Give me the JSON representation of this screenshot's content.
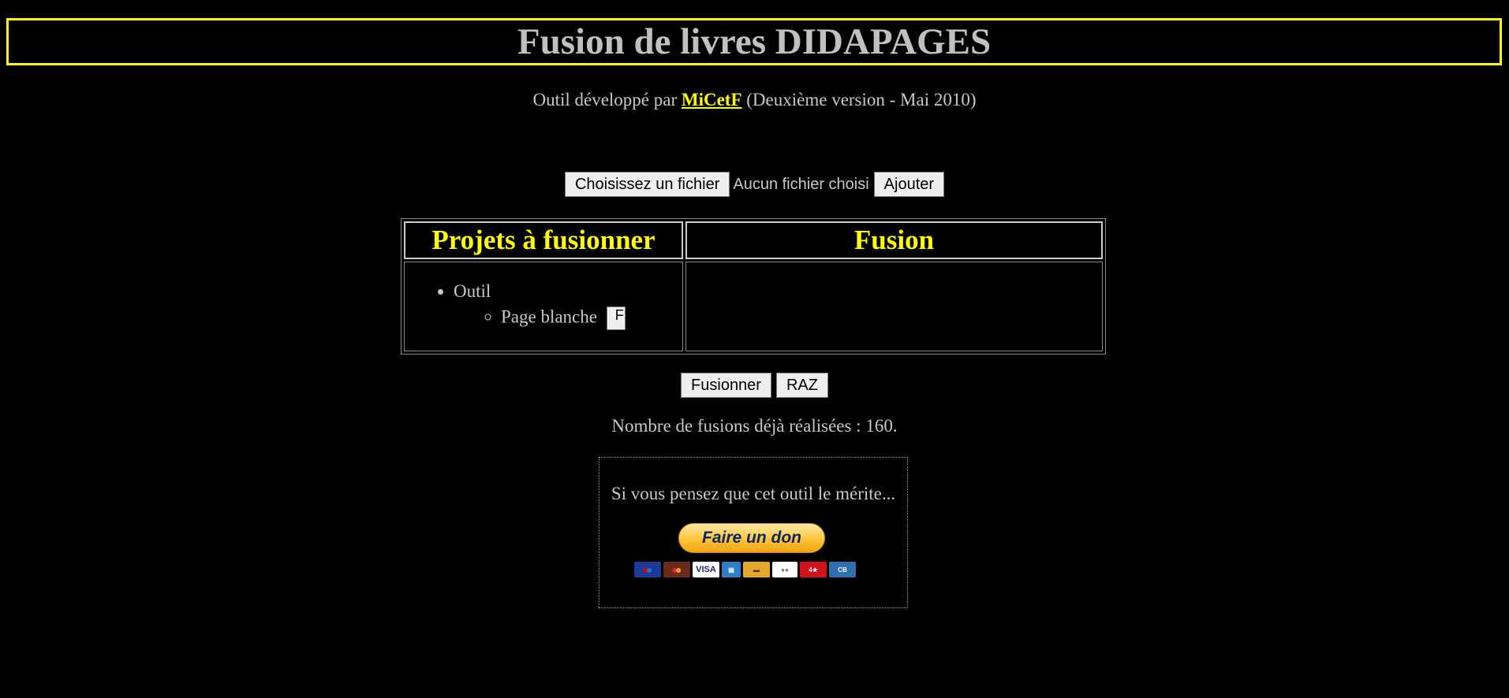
{
  "header": {
    "title": "Fusion de livres DIDAPAGES"
  },
  "credit": {
    "prefix": "Outil développé par ",
    "author": "MiCetF",
    "suffix": " (Deuxième version - Mai 2010)"
  },
  "file_picker": {
    "choose_label": "Choisissez un fichier",
    "status": "Aucun fichier choisi",
    "add_label": "Ajouter"
  },
  "table": {
    "col_projects": "Projets à fusionner",
    "col_fusion": "Fusion",
    "projects": [
      {
        "name": "Outil",
        "pages": [
          {
            "name": "Page blanche",
            "button": "F"
          }
        ]
      }
    ]
  },
  "actions": {
    "merge_label": "Fusionner",
    "reset_label": "RAZ"
  },
  "stats": {
    "count_text": "Nombre de fusions déjà réalisées : 160."
  },
  "donate": {
    "text": "Si vous pensez que cet outil le mérite...",
    "button_label": "Faire un don",
    "card_icons": [
      "maestro-icon",
      "mastercard-icon",
      "visa-icon",
      "amex-icon",
      "aurore-icon",
      "sofinco-icon",
      "4etoiles-icon",
      "cb-icon"
    ]
  },
  "colors": {
    "accent": "#ffff00",
    "background": "#000000",
    "text": "#c8c8c8"
  }
}
